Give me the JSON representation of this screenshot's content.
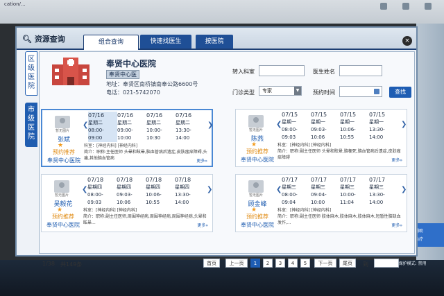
{
  "browser": {
    "tab_text": "cation/...",
    "status_text": "Internet | 保护模式: 禁用"
  },
  "chat_widget": {
    "line1": "病床辅助",
    "line2": "分诊治疗"
  },
  "dialog": {
    "title": "资源查询",
    "tabs": [
      {
        "label": "组合查询",
        "active": true
      },
      {
        "label": "快速找医生",
        "active": false
      },
      {
        "label": "按医院",
        "active": false
      }
    ],
    "close_label": "×"
  },
  "side_tabs": [
    {
      "label": "区级医院",
      "active": true
    },
    {
      "label": "市级医院",
      "active": false
    }
  ],
  "hospital": {
    "name": "奉贤中心医院",
    "selector": "奉贤中心医",
    "address": "地址：奉贤区南桥镇南奉公路6600号",
    "phone": "电话：021-5742070"
  },
  "filters": {
    "dept_label": "转入科室",
    "doctor_label": "医生姓名",
    "type_label": "门诊类型",
    "type_value": "专家",
    "time_label": "预约时间",
    "search_label": "查找"
  },
  "cards": [
    {
      "name": "张斌",
      "rec": "预约推荐",
      "hosp": "奉贤中心医院",
      "avatar": "暂无图片",
      "slots": [
        [
          "07/16",
          "星期二",
          "08:00-09:00"
        ],
        [
          "07/16",
          "星期二",
          "09:00-10:00"
        ],
        [
          "07/16",
          "星期二",
          "10:00-10:30"
        ],
        [
          "07/16",
          "星期二",
          "13:30-14:00"
        ]
      ],
      "dept": "科室：[神经内科]  [神经内科]",
      "intro": "简介：职称:主任医师 头晕和眩晕,脑血管病后遗症,皮肤瘙痒障碍,头痛,其他脑血管病",
      "more": "更多»"
    },
    {
      "name": "陈燕",
      "rec": "预约推荐",
      "hosp": "奉贤中心医院",
      "avatar": "暂无图片",
      "slots": [
        [
          "07/15",
          "星期一",
          "08:00-09:03"
        ],
        [
          "07/15",
          "星期一",
          "09:03-10:06"
        ],
        [
          "07/15",
          "星期一",
          "10:06-10:55"
        ],
        [
          "07/15",
          "星期一",
          "13:30-14:00"
        ]
      ],
      "dept": "科室：[神经内科]  [神经内科]",
      "intro": "简介：职称:副主任医师 头晕和眩晕,脑梗死,脑血管病后遗症,皮肤瘙痒障碍",
      "more": "更多»"
    },
    {
      "name": "吴毅花",
      "rec": "预约推荐",
      "hosp": "奉贤中心医院",
      "avatar": "暂无图片",
      "slots": [
        [
          "07/18",
          "星期四",
          "08:00-09:03"
        ],
        [
          "07/18",
          "星期四",
          "09:03-10:06"
        ],
        [
          "07/18",
          "星期四",
          "10:06-10:55"
        ],
        [
          "07/18",
          "星期四",
          "13:30-14:00"
        ]
      ],
      "dept": "科室：[神经内科]  [神经内科]",
      "intro": "简介：职称:副主任医师,周围神经病,周围神经病,周围神经病,头晕和眩晕...",
      "more": "更多»"
    },
    {
      "name": "顾金峰",
      "rec": "预约推荐",
      "hosp": "奉贤中心医院",
      "avatar": "暂无图片",
      "slots": [
        [
          "07/17",
          "星期三",
          "08:00-09:04"
        ],
        [
          "07/17",
          "星期三",
          "09:04-10:00"
        ],
        [
          "07/17",
          "星期三",
          "10:00-11:04"
        ],
        [
          "07/17",
          "星期三",
          "13:30-14:00"
        ]
      ],
      "dept": "科室：[神经内科]  [神经内科]",
      "intro": "简介：职称:副主任医师 肢体麻木,肢体麻木,肢体麻木,短暂性脑缺血发作,...",
      "more": "更多»"
    }
  ],
  "pagination": {
    "page_info": "1/38",
    "total": "共149条",
    "first": "首页",
    "prev": "上一页",
    "pages": [
      "1",
      "2",
      "3",
      "4",
      "5"
    ],
    "next": "下一页",
    "last": "尾页",
    "goto": "到"
  }
}
